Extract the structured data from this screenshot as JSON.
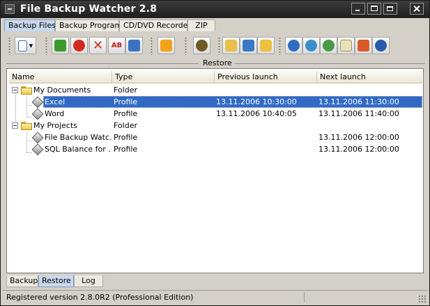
{
  "window": {
    "title": "File Backup Watcher 2.8"
  },
  "top_tabs": [
    {
      "label": "Backup Files",
      "active": true
    },
    {
      "label": "Backup Program",
      "active": false
    },
    {
      "label": "CD/DVD Recorder",
      "active": false
    },
    {
      "label": "ZIP",
      "active": false
    }
  ],
  "toolbar_icons": [
    {
      "name": "new-document-icon",
      "color": "#3a6fb8"
    },
    {
      "name": "run-icon",
      "color": "#3a9a2a"
    },
    {
      "name": "stop-icon",
      "color": "#d42a1e"
    },
    {
      "name": "delete-icon",
      "color": "#d42a1e"
    },
    {
      "name": "rename-icon",
      "color": "#2b54b8"
    },
    {
      "name": "properties-icon",
      "color": "#3c72c4"
    },
    {
      "name": "power-icon",
      "color": "#f2a21a"
    },
    {
      "name": "bug-icon",
      "color": "#6e5a22"
    },
    {
      "name": "open-folder-icon",
      "color": "#e8c04a"
    },
    {
      "name": "import-icon",
      "color": "#3a78c8"
    },
    {
      "name": "export-icon",
      "color": "#f0c040"
    },
    {
      "name": "help-icon",
      "color": "#2f6cc0"
    },
    {
      "name": "web-icon",
      "color": "#3b8fcf"
    },
    {
      "name": "update-icon",
      "color": "#4a9a48"
    },
    {
      "name": "mail-icon",
      "color": "#e8e0b8"
    },
    {
      "name": "windows-icon",
      "color": "#d85a28"
    },
    {
      "name": "about-icon",
      "color": "#2a5aaa"
    }
  ],
  "panel": {
    "title": "Restore"
  },
  "list": {
    "columns": [
      "Name",
      "Type",
      "Previous launch",
      "Next launch"
    ],
    "rows": [
      {
        "name": "My Documents",
        "type": "Folder",
        "previous": "",
        "next": "",
        "kind": "folder"
      },
      {
        "name": "Excel",
        "type": "Profile",
        "previous": "13.11.2006 10:30:00",
        "next": "13.11.2006 11:30:00",
        "kind": "profile",
        "selected": true
      },
      {
        "name": "Word",
        "type": "Profile",
        "previous": "13.11.2006 10:40:05",
        "next": "13.11.2006 11:40:00",
        "kind": "profile"
      },
      {
        "name": "My Projects",
        "type": "Folder",
        "previous": "",
        "next": "",
        "kind": "folder"
      },
      {
        "name": "File Backup Watc...",
        "type": "Profile",
        "previous": "",
        "next": "13.11.2006 12:00:00",
        "kind": "profile"
      },
      {
        "name": "SQL Balance for ...",
        "type": "Profile",
        "previous": "",
        "next": "13.11.2006 12:00:00",
        "kind": "profile"
      }
    ]
  },
  "bottom_tabs": [
    {
      "label": "Backup",
      "active": false
    },
    {
      "label": "Restore",
      "active": true
    },
    {
      "label": "Log",
      "active": false
    }
  ],
  "status": {
    "text": "Registered version 2.8.0R2 (Professional Edition)"
  }
}
